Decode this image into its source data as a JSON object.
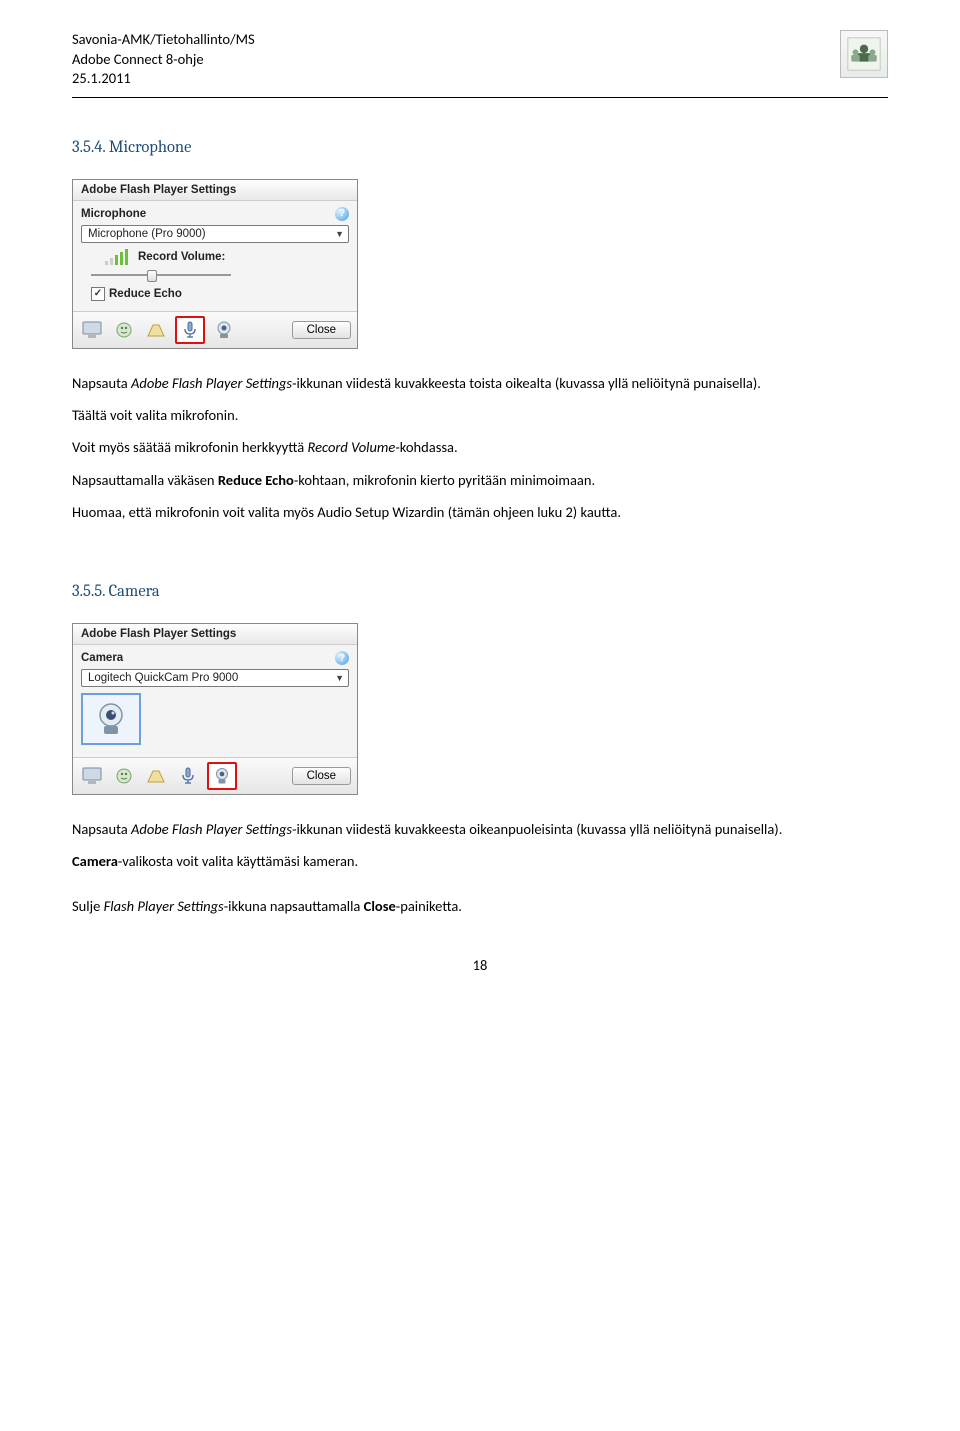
{
  "header": {
    "line1": "Savonia-AMK/Tietohallinto/MS",
    "line2": "Adobe Connect 8-ohje",
    "line3": "25.1.2011"
  },
  "section1": {
    "title": "3.5.4. Microphone",
    "dialog": {
      "title": "Adobe Flash Player Settings",
      "label": "Microphone",
      "dropdown": "Microphone (Pro 9000)",
      "record_label": "Record Volume:",
      "reduce_echo": "Reduce Echo",
      "close": "Close"
    },
    "p1a": "Napsauta ",
    "p1b": "Adobe Flash Player Settings",
    "p1c": "-ikkunan viidestä kuvakkeesta toista oikealta (kuvassa yllä neliöitynä punaisella).",
    "p2": "Täältä voit valita mikrofonin.",
    "p3a": "Voit myös säätää mikrofonin herkkyyttä ",
    "p3b": "Record Volume",
    "p3c": "-kohdassa.",
    "p4a": "Napsauttamalla väkäsen ",
    "p4b": "Reduce Echo",
    "p4c": "-kohtaan, mikrofonin kierto pyritään minimoimaan.",
    "p5": "Huomaa, että mikrofonin voit valita myös Audio Setup Wizardin (tämän ohjeen luku 2) kautta."
  },
  "section2": {
    "title": "3.5.5. Camera",
    "dialog": {
      "title": "Adobe Flash Player Settings",
      "label": "Camera",
      "dropdown": "Logitech QuickCam Pro 9000",
      "close": "Close"
    },
    "p1a": "Napsauta ",
    "p1b": "Adobe Flash Player Settings",
    "p1c": "-ikkunan viidestä kuvakkeesta oikeanpuoleisinta (kuvassa yllä neliöitynä punaisella).",
    "p2a": "Camera",
    "p2b": "-valikosta voit valita käyttämäsi kameran.",
    "p3a": "Sulje ",
    "p3b": "Flash Player Settings",
    "p3c": "-ikkuna napsauttamalla ",
    "p3d": "Close",
    "p3e": "-painiketta."
  },
  "pagenum": "18"
}
